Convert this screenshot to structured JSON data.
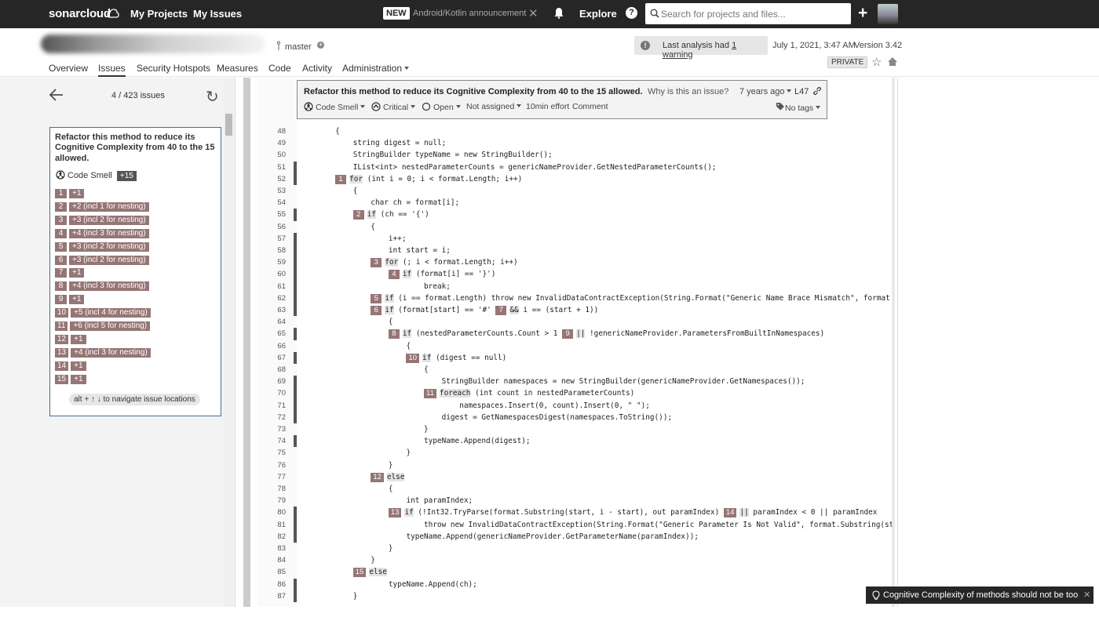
{
  "topnav": {
    "logo": "sonarcloud",
    "links": [
      "My Projects",
      "My Issues",
      "Explore"
    ],
    "new_badge": "NEW",
    "announcement": "Android/Kotlin announcement",
    "search_placeholder": "Search for projects and files..."
  },
  "project": {
    "branch": "master",
    "warning_text": "Last analysis had ",
    "warning_link": "1 warning",
    "analysis_date": "July 1, 2021, 3:47 AM",
    "version": "Version 3.42",
    "visibility": "PRIVATE",
    "tabs": [
      "Overview",
      "Issues",
      "Security Hotspots",
      "Measures",
      "Code",
      "Activity",
      "Administration"
    ],
    "active_tab": "Issues"
  },
  "issues_panel": {
    "count": "4 / 423 issues",
    "issue_title": "Refactor this method to reduce its Cognitive Complexity from 40 to the 15 allowed.",
    "type": "Code Smell",
    "effort_badge": "+15",
    "flows": [
      {
        "n": "1",
        "d": "+1"
      },
      {
        "n": "2",
        "d": "+2 (incl 1 for nesting)"
      },
      {
        "n": "3",
        "d": "+3 (incl 2 for nesting)"
      },
      {
        "n": "4",
        "d": "+4 (incl 3 for nesting)"
      },
      {
        "n": "5",
        "d": "+3 (incl 2 for nesting)"
      },
      {
        "n": "6",
        "d": "+3 (incl 2 for nesting)"
      },
      {
        "n": "7",
        "d": "+1"
      },
      {
        "n": "8",
        "d": "+4 (incl 3 for nesting)"
      },
      {
        "n": "9",
        "d": "+1"
      },
      {
        "n": "10",
        "d": "+5 (incl 4 for nesting)"
      },
      {
        "n": "11",
        "d": "+6 (incl 5 for nesting)"
      },
      {
        "n": "12",
        "d": "+1"
      },
      {
        "n": "13",
        "d": "+4 (incl 3 for nesting)"
      },
      {
        "n": "14",
        "d": "+1"
      },
      {
        "n": "15",
        "d": "+1"
      }
    ],
    "hint": "alt + ↑ ↓ to navigate issue locations"
  },
  "issue_box": {
    "title": "Refactor this method to reduce its Cognitive Complexity from 40 to the 15 allowed.",
    "why": "Why is this an issue?",
    "age": "7 years ago",
    "line": "L47",
    "type": "Code Smell",
    "severity": "Critical",
    "status": "Open",
    "assignee": "Not assigned",
    "effort": "10min effort",
    "comment": "Comment",
    "tags": "No tags"
  },
  "code": {
    "lines": [
      {
        "num": "48",
        "text": "        {",
        "bar": false
      },
      {
        "num": "49",
        "text": "            string digest = null;",
        "bar": false
      },
      {
        "num": "50",
        "text": "            StringBuilder typeName = new StringBuilder();",
        "bar": false
      },
      {
        "num": "51",
        "text": "            IList<int> nestedParameterCounts = genericNameProvider.GetNestedParameterCounts();",
        "bar": true
      },
      {
        "num": "52",
        "text": "        [1]for (int i = 0; i < format.Length; i++)",
        "bar": true
      },
      {
        "num": "53",
        "text": "            {",
        "bar": false
      },
      {
        "num": "54",
        "text": "                char ch = format[i];",
        "bar": false
      },
      {
        "num": "55",
        "text": "            [2]if (ch == '{')",
        "bar": true
      },
      {
        "num": "56",
        "text": "                {",
        "bar": false
      },
      {
        "num": "57",
        "text": "                    i++;",
        "bar": true
      },
      {
        "num": "58",
        "text": "                    int start = i;",
        "bar": true
      },
      {
        "num": "59",
        "text": "                [3]for (; i < format.Length; i++)",
        "bar": true
      },
      {
        "num": "60",
        "text": "                    [4]if (format[i] == '}')",
        "bar": true
      },
      {
        "num": "61",
        "text": "                            break;",
        "bar": true
      },
      {
        "num": "62",
        "text": "                [5]if (i == format.Length) throw new InvalidDataContractException(String.Format(\"Generic Name Brace Mismatch\", format",
        "bar": true
      },
      {
        "num": "63",
        "text": "                [6]if (format[start] == '#' [7]&& i == (start + 1))",
        "bar": true
      },
      {
        "num": "64",
        "text": "                    {",
        "bar": false
      },
      {
        "num": "65",
        "text": "                    [8]if (nestedParameterCounts.Count > 1 [9]|| !genericNameProvider.ParametersFromBuiltInNamespaces)",
        "bar": true
      },
      {
        "num": "66",
        "text": "                        {",
        "bar": false
      },
      {
        "num": "67",
        "text": "                        [10]if (digest == null)",
        "bar": true
      },
      {
        "num": "68",
        "text": "                            {",
        "bar": false
      },
      {
        "num": "69",
        "text": "                                StringBuilder namespaces = new StringBuilder(genericNameProvider.GetNamespaces());",
        "bar": true
      },
      {
        "num": "70",
        "text": "                            [11]foreach (int count in nestedParameterCounts)",
        "bar": true
      },
      {
        "num": "71",
        "text": "                                    namespaces.Insert(0, count).Insert(0, \" \");",
        "bar": true
      },
      {
        "num": "72",
        "text": "                                digest = GetNamespacesDigest(namespaces.ToString());",
        "bar": true
      },
      {
        "num": "73",
        "text": "                            }",
        "bar": false
      },
      {
        "num": "74",
        "text": "                            typeName.Append(digest);",
        "bar": true
      },
      {
        "num": "75",
        "text": "                        }",
        "bar": false
      },
      {
        "num": "76",
        "text": "                    }",
        "bar": false
      },
      {
        "num": "77",
        "text": "                [12]else",
        "bar": false
      },
      {
        "num": "78",
        "text": "                    {",
        "bar": false
      },
      {
        "num": "79",
        "text": "                        int paramIndex;",
        "bar": false
      },
      {
        "num": "80",
        "text": "                    [13]if (!Int32.TryParse(format.Substring(start, i - start), out paramIndex) [14]|| paramIndex < 0 || paramIndex",
        "bar": true
      },
      {
        "num": "81",
        "text": "                            throw new InvalidDataContractException(String.Format(\"Generic Parameter Is Not Valid\", format.Substring(sta",
        "bar": true
      },
      {
        "num": "82",
        "text": "                        typeName.Append(genericNameProvider.GetParameterName(paramIndex));",
        "bar": true
      },
      {
        "num": "83",
        "text": "                    }",
        "bar": false
      },
      {
        "num": "84",
        "text": "                }",
        "bar": false
      },
      {
        "num": "85",
        "text": "            [15]else",
        "bar": false
      },
      {
        "num": "86",
        "text": "                    typeName.Append(ch);",
        "bar": true
      },
      {
        "num": "87",
        "text": "            }",
        "bar": true
      }
    ]
  },
  "toast": {
    "text": "Cognitive Complexity of methods should not be too high"
  }
}
